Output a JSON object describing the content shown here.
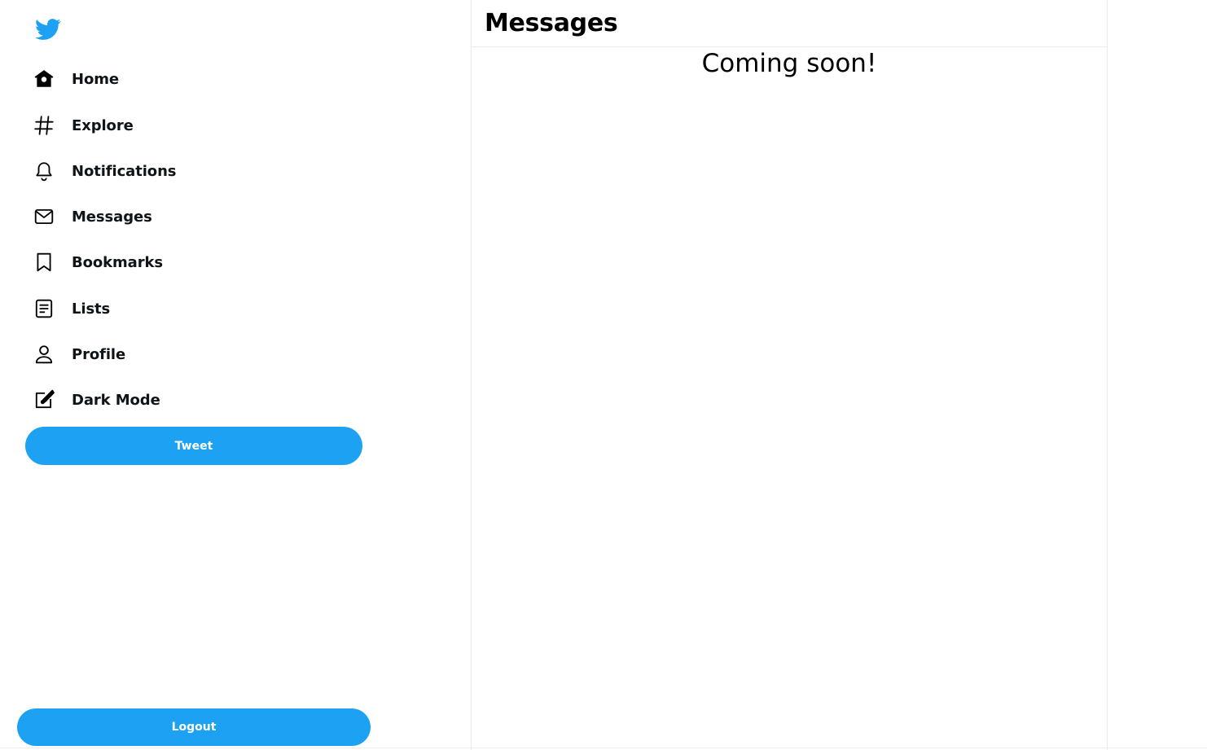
{
  "sidebar": {
    "logo": "twitter-bird-icon",
    "items": [
      {
        "label": "Home",
        "icon": "home-icon"
      },
      {
        "label": "Explore",
        "icon": "hashtag-icon"
      },
      {
        "label": "Notifications",
        "icon": "bell-icon"
      },
      {
        "label": "Messages",
        "icon": "envelope-icon"
      },
      {
        "label": "Bookmarks",
        "icon": "bookmark-icon"
      },
      {
        "label": "Lists",
        "icon": "list-icon"
      },
      {
        "label": "Profile",
        "icon": "person-icon"
      },
      {
        "label": "Dark Mode",
        "icon": "edit-icon"
      }
    ],
    "tweet_label": "Tweet",
    "logout_label": "Logout"
  },
  "main": {
    "title": "Messages",
    "placeholder_text": "Coming soon!"
  },
  "colors": {
    "accent": "#1da1f2",
    "border": "#e6ecf0"
  }
}
